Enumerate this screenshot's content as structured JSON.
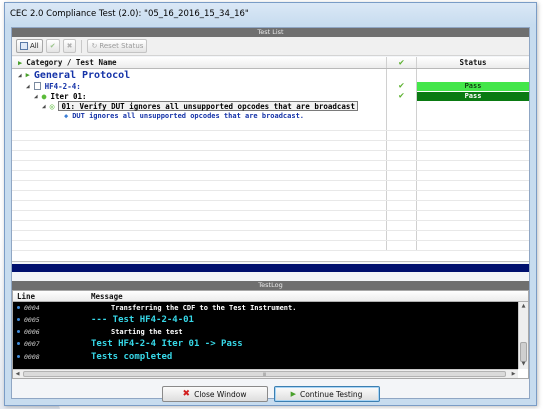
{
  "window": {
    "title": "CEC 2.0 Compliance Test (2.0): \"05_16_2016_15_34_16\""
  },
  "test_list": {
    "header": "Test List",
    "toolbar": {
      "all_label": "All",
      "reset_label": "Reset Status"
    },
    "columns": {
      "name": "Category / Test Name",
      "status": "Status"
    },
    "rows": {
      "protocol": {
        "label": "General Protocol"
      },
      "hf": {
        "label": "HF4-2-4:",
        "status": "Pass"
      },
      "iter": {
        "label": "Iter 01:",
        "status": "Pass"
      },
      "test": {
        "label": "01: Verify DUT ignores all unsupported opcodes that are broadcast"
      },
      "detail": {
        "label": "DUT ignores all unsupported opcodes that are broadcast."
      }
    }
  },
  "test_log": {
    "header": "TestLog",
    "columns": {
      "line": "Line",
      "message": "Message"
    },
    "rows": [
      {
        "line": "0004",
        "message": "Transferring the CDF to the Test Instrument.",
        "style": "white"
      },
      {
        "line": "0005",
        "message": "--- Test HF4-2-4-01",
        "style": "cyan"
      },
      {
        "line": "0006",
        "message": "Starting the test",
        "style": "white"
      },
      {
        "line": "0007",
        "message": "Test HF4-2-4 Iter 01 -> Pass",
        "style": "cyan"
      },
      {
        "line": "0008",
        "message": "Tests completed",
        "style": "cyan"
      }
    ],
    "hscroll_label": "III"
  },
  "footer": {
    "close_label": "Close Window",
    "continue_label": "Continue Testing"
  },
  "colors": {
    "pass_light": "#44e64a",
    "pass_dark": "#0a7a12",
    "progress": "#00106e",
    "log_cyan": "#37d8e8"
  }
}
